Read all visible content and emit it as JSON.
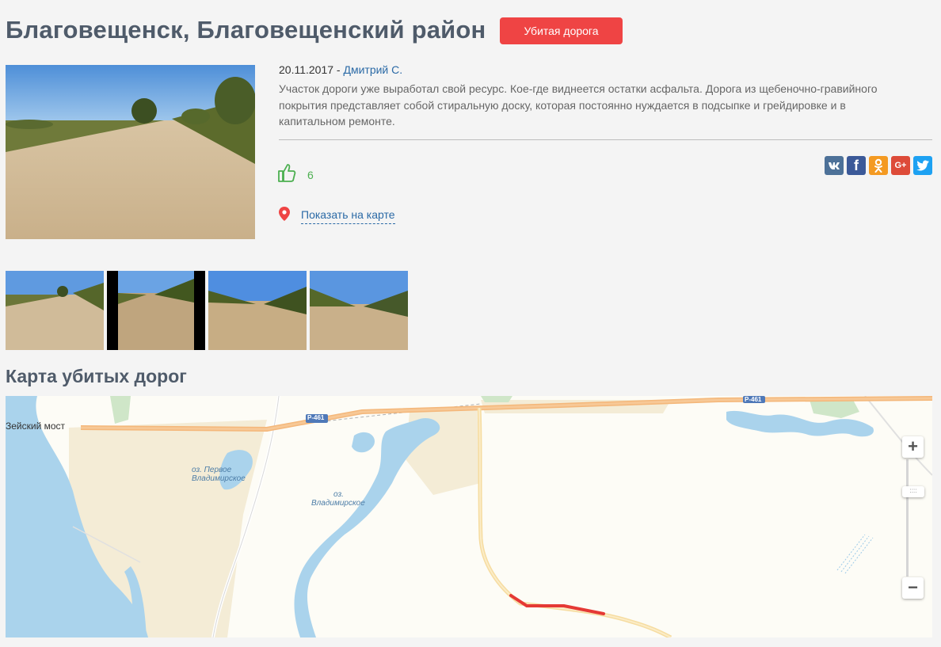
{
  "page": {
    "title": "Благовещенск, Благовещенский район",
    "badge": "Убитая дорога"
  },
  "post": {
    "date": "20.11.2017",
    "separator": " - ",
    "author": "Дмитрий С.",
    "description": "Участок дороги уже выработал свой ресурс. Кое-где виднеется остатки асфальта. Дорога из щебеночно-гравийного покрытия представляет собой стиральную доску, которая постоянно нуждается в подсыпке и грейдировке и в капитальном ремонте.",
    "likes": "6",
    "show_on_map": "Показать на карте"
  },
  "share": {
    "vk": "вк",
    "facebook": "f",
    "odnoklassniki": "ok",
    "google_plus": "G+",
    "twitter": "twitter"
  },
  "section": {
    "map_title": "Карта убитых дорог"
  },
  "map": {
    "labels": {
      "bridge": "Зейский мост",
      "road_code_1": "Р-461",
      "road_code_2": "Р-461",
      "lake1_line1": "оз. Первое",
      "lake1_line2": "Владимирское",
      "lake2_line1": "оз.",
      "lake2_line2": "Владимирское"
    },
    "zoom_in": "+",
    "zoom_out": "−",
    "damaged_color": "#e53935"
  },
  "colors": {
    "badge": "#ef4444",
    "link": "#2b6aa6",
    "like": "#4caf50"
  }
}
